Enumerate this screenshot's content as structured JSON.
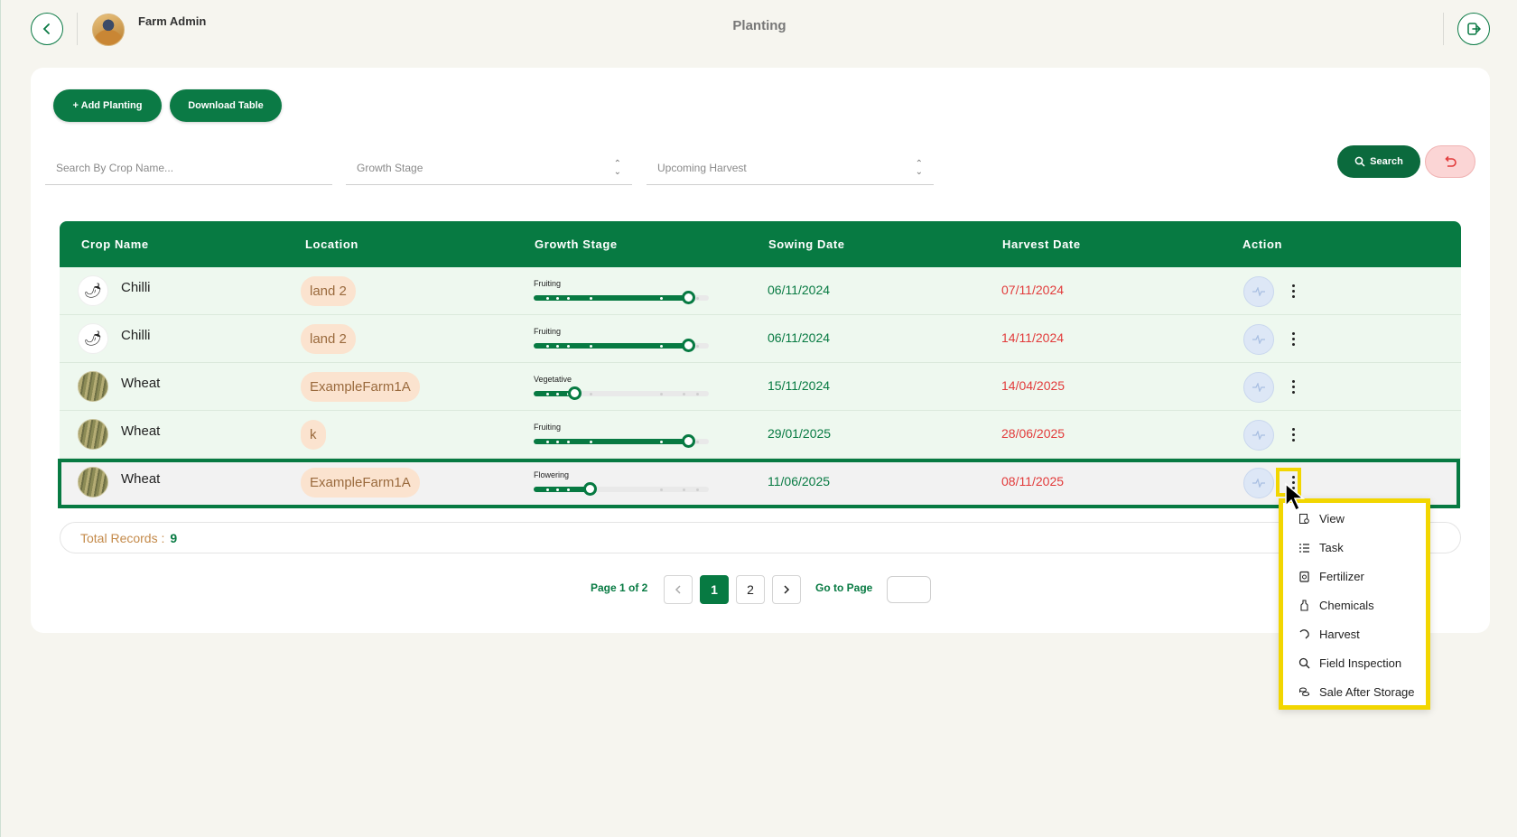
{
  "header": {
    "user_name": "Farm Admin",
    "page_title": "Planting"
  },
  "toolbar": {
    "add_label": "+ Add Planting",
    "download_label": "Download Table"
  },
  "filters": {
    "crop_placeholder": "Search By Crop Name...",
    "growth_stage_placeholder": "Growth Stage",
    "upcoming_harvest_placeholder": "Upcoming Harvest",
    "search_label": "Search"
  },
  "table": {
    "columns": [
      "Crop Name",
      "Location",
      "Growth Stage",
      "Sowing Date",
      "Harvest Date",
      "Action"
    ],
    "rows": [
      {
        "crop": "Chilli",
        "icon": "chilli",
        "location": "land 2",
        "stage": "Fruiting",
        "progress": 0.88,
        "sowing": "06/11/2024",
        "harvest": "07/11/2024"
      },
      {
        "crop": "Chilli",
        "icon": "chilli",
        "location": "land 2",
        "stage": "Fruiting",
        "progress": 0.88,
        "sowing": "06/11/2024",
        "harvest": "14/11/2024"
      },
      {
        "crop": "Wheat",
        "icon": "wheat",
        "location": "ExampleFarm1A",
        "stage": "Vegetative",
        "progress": 0.23,
        "sowing": "15/11/2024",
        "harvest": "14/04/2025"
      },
      {
        "crop": "Wheat",
        "icon": "wheat",
        "location": "k",
        "stage": "Fruiting",
        "progress": 0.88,
        "sowing": "29/01/2025",
        "harvest": "28/06/2025"
      },
      {
        "crop": "Wheat",
        "icon": "wheat",
        "location": "ExampleFarm1A",
        "stage": "Flowering",
        "progress": 0.32,
        "sowing": "11/06/2025",
        "harvest": "08/11/2025"
      }
    ]
  },
  "footer": {
    "total_label": "Total Records :",
    "total_value": "9",
    "page_info": "Page 1 of 2",
    "pages": [
      "1",
      "2"
    ],
    "current_page": "1",
    "goto_label": "Go to Page"
  },
  "action_menu": {
    "items": [
      {
        "label": "View",
        "icon": "view-icon"
      },
      {
        "label": "Task",
        "icon": "task-list-icon"
      },
      {
        "label": "Fertilizer",
        "icon": "fertilizer-bag-icon"
      },
      {
        "label": "Chemicals",
        "icon": "bottle-icon"
      },
      {
        "label": "Harvest",
        "icon": "sickle-icon"
      },
      {
        "label": "Field Inspection",
        "icon": "magnifier-icon"
      },
      {
        "label": "Sale After Storage",
        "icon": "coins-icon"
      }
    ]
  },
  "colors": {
    "primary": "#077a42",
    "harvest_date": "#e23b3b",
    "location_badge": "#fbe3cf",
    "highlight": "#f2d600"
  }
}
